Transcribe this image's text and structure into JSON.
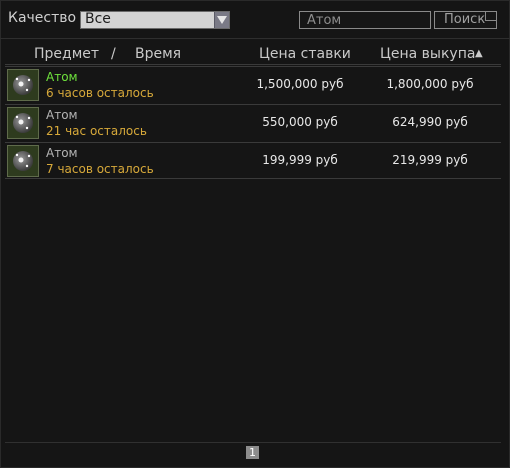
{
  "toolbar": {
    "quality_label": "Качество",
    "quality_value": "Все",
    "search_value": "Атом",
    "search_button": "Поиск"
  },
  "columns": {
    "item": "Предмет",
    "divider": "/",
    "time": "Время",
    "bid": "Цена ставки",
    "buyout": "Цена выкупа",
    "sort_indicator": "▲"
  },
  "rows": [
    {
      "name": "Атом",
      "time_left": "6 часов осталось",
      "bid": "1,500,000 руб",
      "buyout": "1,800,000 руб",
      "name_color": "#6ee23c",
      "icon": "atom-orb-icon"
    },
    {
      "name": "Атом",
      "time_left": "21 час осталось",
      "bid": "550,000 руб",
      "buyout": "624,990 руб",
      "name_color": "#b4b4b4",
      "icon": "atom-orb-icon"
    },
    {
      "name": "Атом",
      "time_left": "7 часов осталось",
      "bid": "199,999 руб",
      "buyout": "219,999 руб",
      "name_color": "#b4b4b4",
      "icon": "atom-orb-icon"
    }
  ],
  "pagination": {
    "current_page": "1"
  }
}
